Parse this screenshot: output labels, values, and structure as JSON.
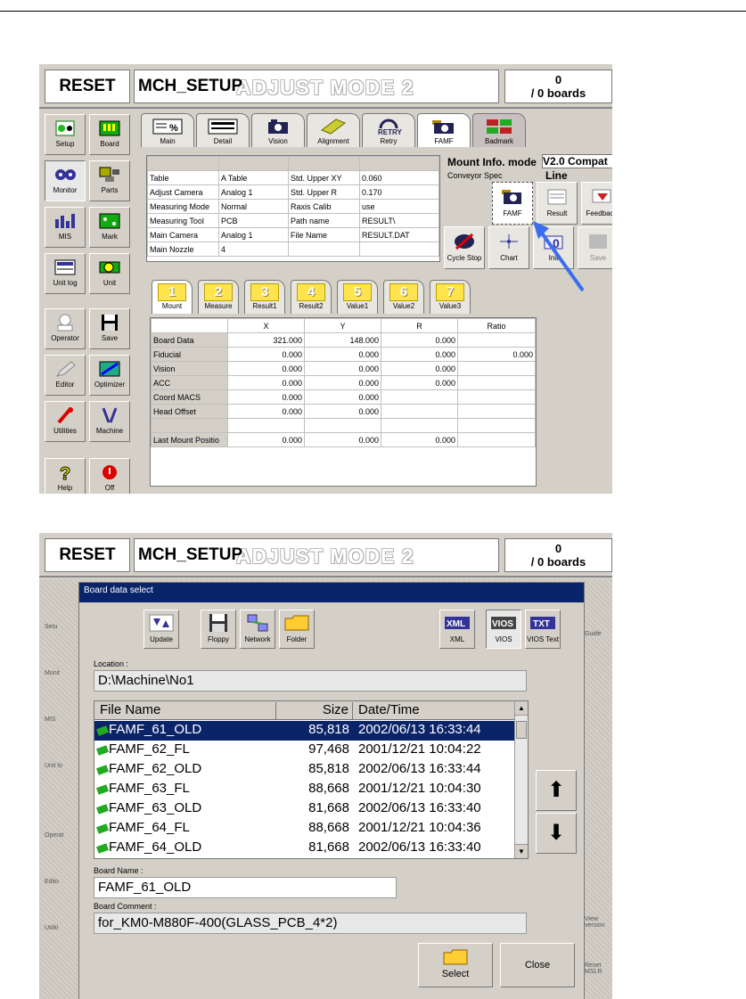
{
  "header": {
    "reset_label": "RESET",
    "title": "MCH_SETUP",
    "mode": "ADJUST MODE 2",
    "count_top": "0",
    "count_bottom": "/ 0 boards"
  },
  "sidebar": {
    "items": [
      {
        "label": "Setup",
        "icon": "setup-icon"
      },
      {
        "label": "Board",
        "icon": "board-icon"
      },
      {
        "label": "Monitor",
        "icon": "monitor-icon"
      },
      {
        "label": "Parts",
        "icon": "parts-icon"
      },
      {
        "label": "MIS",
        "icon": "mis-icon"
      },
      {
        "label": "Mark",
        "icon": "mark-icon"
      },
      {
        "label": "Unit log",
        "icon": "unit-log-icon"
      },
      {
        "label": "Unit",
        "icon": "unit-icon"
      },
      {
        "label": "Operator",
        "icon": "operator-icon"
      },
      {
        "label": "Save",
        "icon": "floppy-icon"
      },
      {
        "label": "Editor",
        "icon": "editor-icon"
      },
      {
        "label": "Optimizer",
        "icon": "optimizer-icon"
      },
      {
        "label": "Utilities",
        "icon": "utilities-icon"
      },
      {
        "label": "Machine",
        "icon": "machine-icon"
      },
      {
        "label": "Help",
        "icon": "help-icon"
      },
      {
        "label": "Off",
        "icon": "power-icon"
      }
    ]
  },
  "top_tabs": [
    {
      "label": "Main",
      "icon": "percent-icon"
    },
    {
      "label": "Detail",
      "icon": "detail-icon"
    },
    {
      "label": "Vision",
      "icon": "camera-icon"
    },
    {
      "label": "Alignment",
      "icon": "alignment-icon"
    },
    {
      "label": "Retry",
      "icon": "retry-icon",
      "badge": "RETRY"
    },
    {
      "label": "FAMF",
      "icon": "camera-icon"
    },
    {
      "label": "Badmark",
      "icon": "badmark-icon"
    }
  ],
  "info_table": {
    "rows": [
      [
        "Table",
        "A Table",
        "Std. Upper XY",
        "0.060"
      ],
      [
        "Adjust Camera",
        "Analog 1",
        "Std. Upper R",
        "0.170"
      ],
      [
        "Measuring Mode",
        "Normal",
        "Raxis Calib",
        "use"
      ],
      [
        "Measuring Tool",
        "PCB",
        "Path name",
        "RESULT\\"
      ],
      [
        "Main Camera",
        "Analog 1",
        "File Name",
        "RESULT.DAT"
      ],
      [
        "Main Nozzle",
        "4",
        "",
        ""
      ]
    ]
  },
  "mount_info": {
    "title": "Mount Info. mode",
    "compat": "V2.0 Compat",
    "line": "Line",
    "conveyor": "Conveyor Spec"
  },
  "right_buttons": [
    {
      "label": "FAMF",
      "icon": "camera-icon"
    },
    {
      "label": "Result",
      "icon": "result-icon"
    },
    {
      "label": "Feedback",
      "icon": "feedback-icon"
    },
    {
      "label": "Cycle Stop",
      "icon": "cycle-stop-icon"
    },
    {
      "label": "Chart",
      "icon": "chart-icon"
    },
    {
      "label": "Init",
      "icon": "init-icon"
    },
    {
      "label": "Save",
      "icon": "save-icon"
    }
  ],
  "num_tabs": [
    {
      "num": "1",
      "label": "Mount"
    },
    {
      "num": "2",
      "label": "Measure"
    },
    {
      "num": "3",
      "label": "Result1"
    },
    {
      "num": "4",
      "label": "Result2"
    },
    {
      "num": "5",
      "label": "Value1"
    },
    {
      "num": "6",
      "label": "Value2"
    },
    {
      "num": "7",
      "label": "Value3"
    }
  ],
  "mount_table": {
    "headers": [
      "",
      "X",
      "Y",
      "R",
      "Ratio"
    ],
    "rows": [
      [
        "Board Data",
        "321.000",
        "148.000",
        "0.000",
        ""
      ],
      [
        "Fiducial",
        "0.000",
        "0.000",
        "0.000",
        "0.000"
      ],
      [
        "Vision",
        "0.000",
        "0.000",
        "0.000",
        ""
      ],
      [
        "ACC",
        "0.000",
        "0.000",
        "0.000",
        ""
      ],
      [
        "Coord MACS",
        "0.000",
        "0.000",
        "",
        ""
      ],
      [
        "Head Offset",
        "0.000",
        "0.000",
        "",
        ""
      ],
      [
        "",
        "",
        "",
        "",
        ""
      ],
      [
        "Last Mount Positio",
        "0.000",
        "0.000",
        "0.000",
        ""
      ]
    ]
  },
  "dialog": {
    "title": "Board data select",
    "left_buttons": [
      {
        "label": "Update",
        "icon": "update-icon"
      },
      {
        "label": "Floppy",
        "icon": "floppy-icon"
      },
      {
        "label": "Network",
        "icon": "network-icon"
      },
      {
        "label": "Folder",
        "icon": "folder-icon"
      }
    ],
    "right_buttons": [
      {
        "label": "XML",
        "icon": "xml-icon",
        "badge": "XML"
      },
      {
        "label": "VIOS",
        "icon": "vios-icon",
        "badge": "VIOS"
      },
      {
        "label": "VIOS Text",
        "icon": "txt-icon",
        "badge": "TXT"
      }
    ],
    "location_label": "Location :",
    "location": "D:\\Machine\\No1",
    "columns": [
      "File Name",
      "Size",
      "Date/Time"
    ],
    "files": [
      {
        "name": "FAMF_61_OLD",
        "size": "85,818",
        "date": "2002/06/13 16:33:44"
      },
      {
        "name": "FAMF_62_FL",
        "size": "97,468",
        "date": "2001/12/21 10:04:22"
      },
      {
        "name": "FAMF_62_OLD",
        "size": "85,818",
        "date": "2002/06/13 16:33:44"
      },
      {
        "name": "FAMF_63_FL",
        "size": "88,668",
        "date": "2001/12/21 10:04:30"
      },
      {
        "name": "FAMF_63_OLD",
        "size": "81,668",
        "date": "2002/06/13 16:33:40"
      },
      {
        "name": "FAMF_64_FL",
        "size": "88,668",
        "date": "2001/12/21 10:04:36"
      },
      {
        "name": "FAMF_64_OLD",
        "size": "81,668",
        "date": "2002/06/13 16:33:40"
      }
    ],
    "board_name_label": "Board Name :",
    "board_name": "FAMF_61_OLD",
    "board_comment_label": "Board Comment :",
    "board_comment": "for_KM0-M880F-400(GLASS_PCB_4*2)",
    "select_label": "Select",
    "close_label": "Close"
  },
  "behind_dialog": {
    "left_labels": [
      "Setu",
      "Monit",
      "MIS",
      "Unit lo",
      "Operat",
      "Edito",
      "Utiliti"
    ],
    "right_labels": [
      "Guide",
      "View version",
      "Reset MSLR"
    ]
  }
}
